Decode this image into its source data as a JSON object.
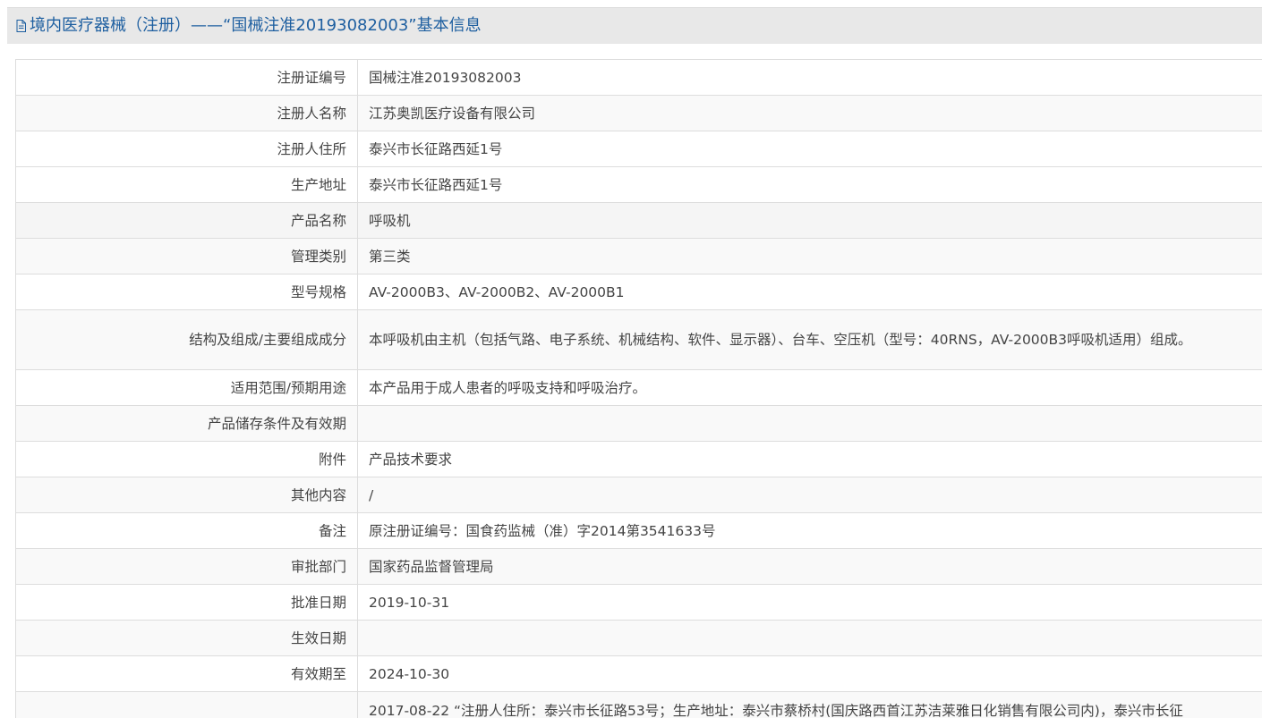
{
  "header": {
    "icon": "document-icon",
    "title": "境内医疗器械（注册）——“国械注准20193082003”基本信息"
  },
  "colors": {
    "header_bg": "#e8e8e8",
    "header_text": "#1e5fa0",
    "border": "#dddddd",
    "text": "#444444",
    "row_alt": "#f9f9f9"
  },
  "rows": [
    {
      "label": "注册证编号",
      "value": "国械注准20193082003"
    },
    {
      "label": "注册人名称",
      "value": "江苏奥凯医疗设备有限公司"
    },
    {
      "label": "注册人住所",
      "value": "泰兴市长征路西延1号"
    },
    {
      "label": "生产地址",
      "value": "泰兴市长征路西延1号"
    },
    {
      "label": "产品名称",
      "value": "呼吸机"
    },
    {
      "label": "管理类别",
      "value": "第三类"
    },
    {
      "label": "型号规格",
      "value": "AV-2000B3、AV-2000B2、AV-2000B1"
    },
    {
      "label": "结构及组成/主要组成成分",
      "value": "本呼吸机由主机（包括气路、电子系统、机械结构、软件、显示器）、台车、空压机（型号：40RNS，AV-2000B3呼吸机适用）组成。"
    },
    {
      "label": "适用范围/预期用途",
      "value": "本产品用于成人患者的呼吸支持和呼吸治疗。"
    },
    {
      "label": "产品储存条件及有效期",
      "value": ""
    },
    {
      "label": "附件",
      "value": "产品技术要求"
    },
    {
      "label": "其他内容",
      "value": "/"
    },
    {
      "label": "备注",
      "value": "原注册证编号：国食药监械（准）字2014第3541633号"
    },
    {
      "label": "审批部门",
      "value": "国家药品监督管理局"
    },
    {
      "label": "批准日期",
      "value": "2019-10-31"
    },
    {
      "label": "生效日期",
      "value": ""
    },
    {
      "label": "有效期至",
      "value": "2024-10-30"
    },
    {
      "label": "",
      "value": "2017-08-22 “注册人住所：泰兴市长征路53号；生产地址：泰兴市蔡桥村(国庆路西首江苏洁莱雅日化销售有限公司内)，泰兴市长征"
    }
  ]
}
